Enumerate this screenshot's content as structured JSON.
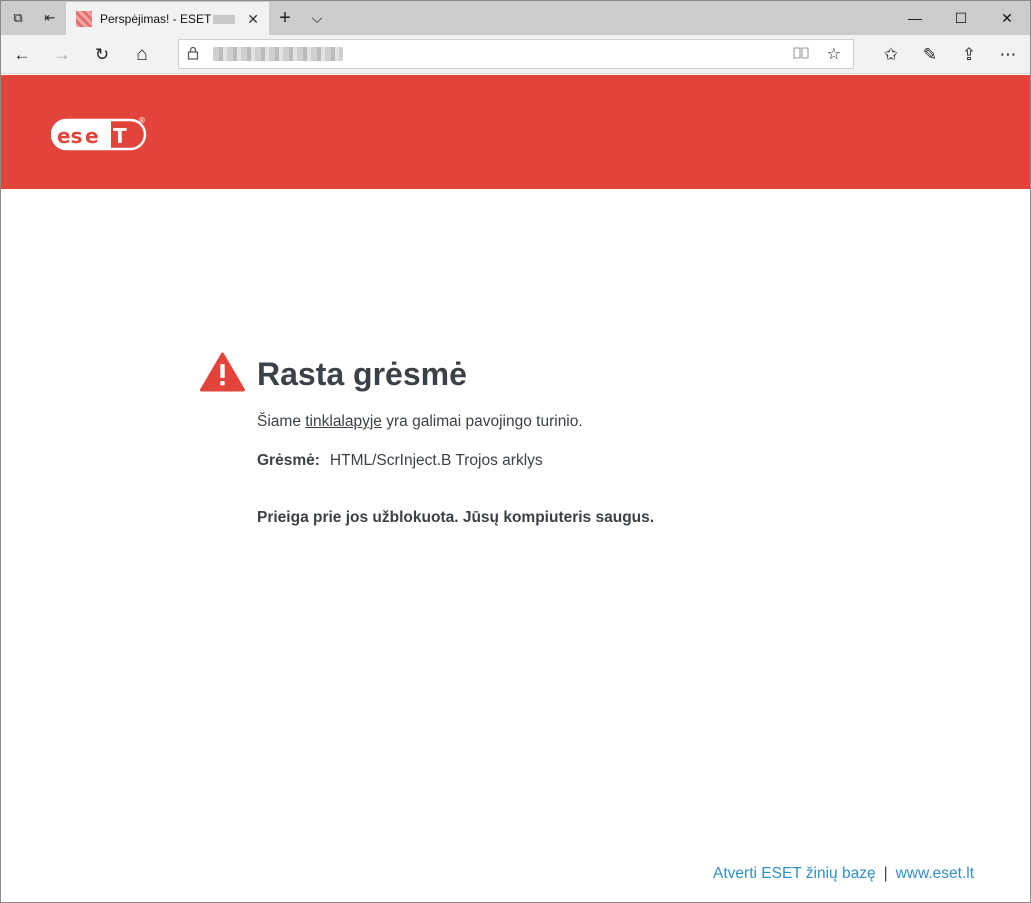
{
  "browser": {
    "tab": {
      "title": "Perspėjimas! - ESET",
      "close": "✕"
    },
    "tab_icons": {
      "set_aside": "⧉",
      "show_aside": "⇤",
      "new_tab": "+",
      "tab_list": "⌵"
    },
    "window_controls": {
      "minimize": "—",
      "maximize": "☐",
      "close": "✕"
    },
    "nav": {
      "back": "←",
      "forward": "→",
      "refresh": "↻",
      "home": "⌂"
    },
    "address": {
      "value": "",
      "lock": "🔒",
      "reading_view": "📖",
      "favorite": "☆"
    },
    "toolbar": {
      "favorites": "✩",
      "notes": "✎",
      "share": "⇪",
      "more": "⋯"
    }
  },
  "brand": {
    "logo_text": "eset",
    "registered": "®",
    "header_color": "#e2433a"
  },
  "alert": {
    "title": "Rasta grėsmė",
    "lead_before": "Šiame ",
    "lead_link": "tinklalapyje",
    "lead_after": " yra galimai pavojingo turinio.",
    "threat_label": "Grėsmė:",
    "threat_value": "HTML/ScrInject.B Trojos arklys",
    "blocked": "Prieiga prie jos užblokuota. Jūsų kompiuteris saugus."
  },
  "footer": {
    "kb_link": "Atverti ESET žinių bazę",
    "separator": "|",
    "site_link": "www.eset.lt"
  }
}
